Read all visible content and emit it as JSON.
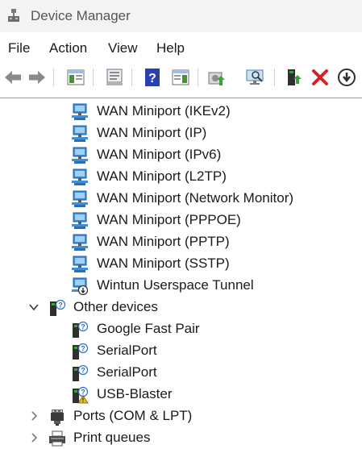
{
  "window": {
    "title": "Device Manager"
  },
  "menu": [
    "File",
    "Action",
    "View",
    "Help"
  ],
  "toolbar": {
    "buttons": [
      "back",
      "forward",
      "show-hide-console-tree",
      "properties",
      "help",
      "action-pane",
      "update-driver",
      "scan-hardware",
      "enable-device",
      "uninstall-device",
      "disable-device"
    ]
  },
  "tree": {
    "network_adapters_tail": [
      "WAN Miniport (IKEv2)",
      "WAN Miniport (IP)",
      "WAN Miniport (IPv6)",
      "WAN Miniport (L2TP)",
      "WAN Miniport (Network Monitor)",
      "WAN Miniport (PPPOE)",
      "WAN Miniport (PPTP)",
      "WAN Miniport (SSTP)",
      "Wintun Userspace Tunnel"
    ],
    "other_devices": {
      "label": "Other devices",
      "expanded": true,
      "items": [
        "Google Fast Pair",
        "SerialPort",
        "SerialPort",
        "USB-Blaster"
      ]
    },
    "ports": {
      "label": "Ports (COM & LPT)",
      "expanded": false
    },
    "print_queues": {
      "label": "Print queues",
      "expanded": false
    }
  },
  "colors": {
    "accent": "#2b7fd6",
    "error": "#d3222a",
    "warning": "#f2c200"
  }
}
